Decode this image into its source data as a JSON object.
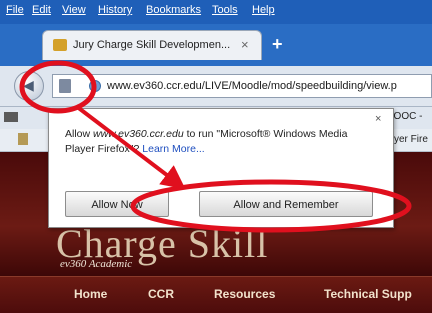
{
  "menubar": {
    "items": [
      "File",
      "Edit",
      "View",
      "History",
      "Bookmarks",
      "Tools",
      "Help"
    ]
  },
  "tab": {
    "title": "Jury Charge Skill Developmen...",
    "close": "×"
  },
  "new_tab": "+",
  "urlbar": {
    "url": "www.ev360.ccr.edu/LIVE/Moodle/mod/speedbuilding/view.p"
  },
  "bookmarks": {
    "partial_item": "LOOC -"
  },
  "toolbar2": {
    "partial_text": "yer Fire"
  },
  "popup": {
    "close": "×",
    "message_before": "Allow ",
    "message_site": "www.ev360.ccr.edu",
    "message_after": " to run \"Microsoft® Windows Media Player Firefox\"? ",
    "learn_more": "Learn More...",
    "allow_now": "Allow Now",
    "allow_remember": "Allow and Remember"
  },
  "page": {
    "banner_title": "Charge Skill",
    "subtitle": "ev360 Academic",
    "nav": [
      "Home",
      "CCR",
      "Resources",
      "Technical Supp"
    ]
  },
  "colors": {
    "annotation": "#e0101e",
    "banner": "#6c1b14",
    "chrome": "#2a6dc4"
  }
}
